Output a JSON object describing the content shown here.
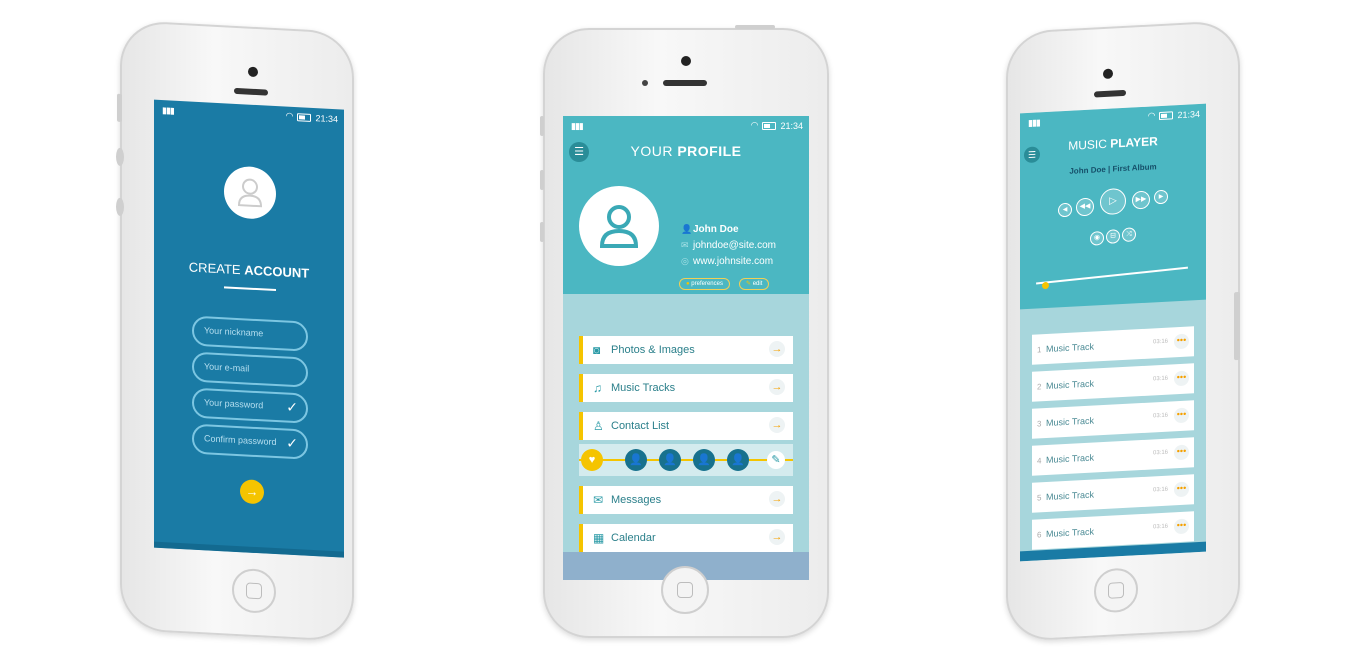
{
  "phones": {
    "create_account": {
      "status": {
        "signal": "signal-icon",
        "time": "21:34"
      },
      "title_light": "CREATE ",
      "title_bold": "ACCOUNT",
      "fields": [
        {
          "placeholder": "Your nickname",
          "checked": false
        },
        {
          "placeholder": "Your e-mail",
          "checked": false
        },
        {
          "placeholder": "Your password",
          "checked": true
        },
        {
          "placeholder": "Confirm password",
          "checked": true
        }
      ],
      "check_glyph": "✓",
      "submit_glyph": "→"
    },
    "profile": {
      "status": {
        "time": "21:34"
      },
      "title_light": "YOUR ",
      "title_bold": "PROFILE",
      "menu_glyph": "☰",
      "name": "John Doe",
      "email": "johndoe@site.com",
      "website": "www.johnsite.com",
      "preferences_label": "preferences",
      "edit_label": "edit",
      "menu": [
        {
          "icon": "camera-icon",
          "glyph": "📷",
          "label": "Photos & Images"
        },
        {
          "icon": "music-icon",
          "glyph": "♫",
          "label": "Music Tracks"
        },
        {
          "icon": "contact-icon",
          "glyph": "👤",
          "label": "Contact List"
        },
        {
          "icon": "mail-icon",
          "glyph": "✉",
          "label": "Messages"
        },
        {
          "icon": "calendar-icon",
          "glyph": "▦",
          "label": "Calendar"
        }
      ],
      "arrow_glyph": "→",
      "favorite_glyph": "♥",
      "edit_glyph": "✎",
      "contact_count": 4
    },
    "music_player": {
      "status": {
        "time": "21:34"
      },
      "title_light": "MUSIC ",
      "title_bold": "PLAYER",
      "album": "John Doe | First Album",
      "progress": 0.05,
      "tracks": [
        {
          "n": "1",
          "title": "Music Track",
          "duration": "03:16"
        },
        {
          "n": "2",
          "title": "Music Track",
          "duration": "03:16"
        },
        {
          "n": "3",
          "title": "Music Track",
          "duration": "03:16"
        },
        {
          "n": "4",
          "title": "Music Track",
          "duration": "03:16"
        },
        {
          "n": "5",
          "title": "Music Track",
          "duration": "03:16"
        },
        {
          "n": "6",
          "title": "Music Track",
          "duration": "03:16"
        }
      ],
      "more_glyph": "•••"
    }
  },
  "colors": {
    "accent": "#f5c400",
    "teal": "#4bb7c2",
    "blue": "#1a7ba5"
  }
}
